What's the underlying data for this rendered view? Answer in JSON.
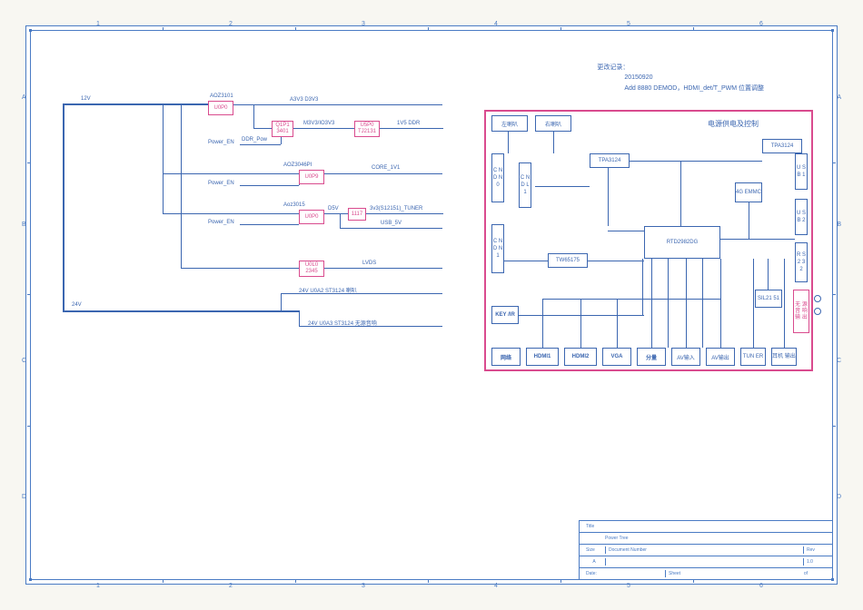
{
  "revision": {
    "title": "更改记录：",
    "date": "20150920",
    "desc": "Add 8880 DEMOD，HDMI_det/T_PWM 位置调整"
  },
  "zones": {
    "cols": [
      "1",
      "2",
      "3",
      "4",
      "5",
      "6"
    ],
    "rows": [
      "A",
      "B",
      "C",
      "D"
    ]
  },
  "rails": {
    "v12": "12V",
    "v24": "24V"
  },
  "blocks": {
    "u0p0": {
      "label": "U0P0",
      "ref": "AOZ3101"
    },
    "q1p1": {
      "label": "Q1P1\n3401"
    },
    "u5p0": {
      "label": "U5P0\nTJ2131"
    },
    "u0p9": {
      "label": "U0P9",
      "ref": "AOZ3046PI"
    },
    "u0p0b": {
      "label": "U0P0",
      "ref": "Aoz3015"
    },
    "u1117": {
      "label": "1117"
    },
    "u0l0": {
      "label": "U0L0\n2345"
    }
  },
  "nets": {
    "a3v3": "A3V3  D3V3",
    "m3v3": "M3V3/IO3V3",
    "ddr_pow": "DDR_Pow",
    "v1v5": "1V5  DDR",
    "pen": "Power_EN",
    "core": "CORE_1V1",
    "d5v": "D5V",
    "tuner": "3v3(S12151)_TUNER",
    "usb5v": "USB_5V",
    "lvds": "LVDS",
    "sp1": "24V  U0A2 ST3124    喇叭",
    "sp2": "24V  U0A3 ST3124   无源音响"
  },
  "board": {
    "spk_l": "左喇叭",
    "spk_r": "右喇叭",
    "pwr": "电源供电及控制",
    "tpa_l": "TPA3124",
    "tpa_r": "TPA3124",
    "emmc": "4G\nEMMC",
    "cndn0": "C\nN\nD\nN\n0",
    "cndl1": "C\nN\nD\nL\n1",
    "cndn1": "C\nN\nD\nN\n1",
    "rtd": "RTD2982DG",
    "tw651": "TW65175",
    "usb1": "U\nS\nB\n1",
    "usb2": "U\nS\nB\n2",
    "rs232": "R\nS\n2\n3\n2",
    "key": "KEY\n/IR",
    "sil": "SIL21\n51",
    "audio": "无\n源\n音\n响\n输\n出",
    "net": "网络",
    "hdmi1": "HDMI1",
    "hdmi2": "HDMI2",
    "vga": "VGA",
    "ypbpr": "分量",
    "avin": "AV输入",
    "avout": "AV输出",
    "tun": "TUN\nER",
    "hp": "耳机\n输出"
  },
  "title": {
    "t": "Title",
    "name": "Power Tree",
    "size": "Size",
    "a": "A",
    "doc": "Document Number",
    "rev": "Rev",
    "revn": "1.0",
    "date": "Date:",
    "sheet": "Sheet",
    "of": "of"
  }
}
